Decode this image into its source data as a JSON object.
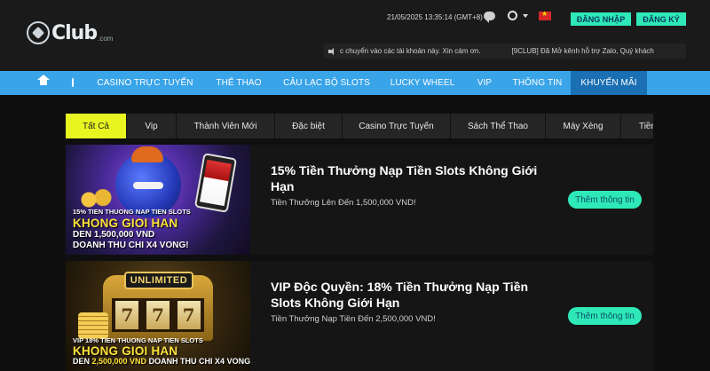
{
  "header": {
    "logo_text": "Club",
    "logo_suffix": ".com",
    "datetime": "21/05/2025 13:35:14 (GMT+8)",
    "login_label": "ĐĂNG NHẬP",
    "register_label": "ĐĂNG KÝ",
    "marquee_text_1": "c chuyển vào các tài khoản này. Xin cám ơn.",
    "marquee_text_2": "[9CLUB] Đã Mở kênh hỗ trợ Zalo, Quý khách"
  },
  "nav": {
    "items": [
      {
        "label": "CASINO TRỰC TUYẾN"
      },
      {
        "label": "THỂ THAO"
      },
      {
        "label": "CÂU LẠC BỘ SLOTS"
      },
      {
        "label": "LUCKY WHEEL"
      },
      {
        "label": "VIP"
      },
      {
        "label": "THÔNG TIN"
      },
      {
        "label": "KHUYẾN MÃI"
      }
    ]
  },
  "tabs": [
    {
      "label": "Tất Cả"
    },
    {
      "label": "Vip"
    },
    {
      "label": "Thành Viên Mới"
    },
    {
      "label": "Đặc biệt"
    },
    {
      "label": "Casino Trực Tuyến"
    },
    {
      "label": "Sách Thể Thao"
    },
    {
      "label": "Máy Xèng"
    },
    {
      "label": "Tiền"
    }
  ],
  "promos": [
    {
      "title": "15% Tiền Thưởng Nạp Tiền Slots Không Giới Hạn",
      "subtitle": "Tiền Thưởng Lên Đến 1,500,000 VND!",
      "button": "Thêm thông tin",
      "banner_line1": "15% TIEN THUONG NAP TIEN SLOTS",
      "banner_line2": "KHONG GIOI HAN",
      "banner_line3": "DEN 1,500,000 VND",
      "banner_line4": "DOANH THU CHI X4 VONG!"
    },
    {
      "title": "VIP Độc Quyền: 18% Tiền Thưởng Nạp Tiền Slots Không Giới Hạn",
      "subtitle": "Tiền Thưởng Nạp Tiền Đến 2,500,000 VND!",
      "button": "Thêm thông tin",
      "banner_badge": "UNLIMITED",
      "reel_symbol": "7",
      "banner_line1": "VIP 18% TIEN THUONG NAP TIEN SLOTS",
      "banner_line2": "KHONG GIOI HAN",
      "banner_line3_a": "DEN ",
      "banner_line3_b": "2,500,000 VND",
      "banner_line3_c": " DOANH THU CHI X4 VONG!"
    }
  ]
}
